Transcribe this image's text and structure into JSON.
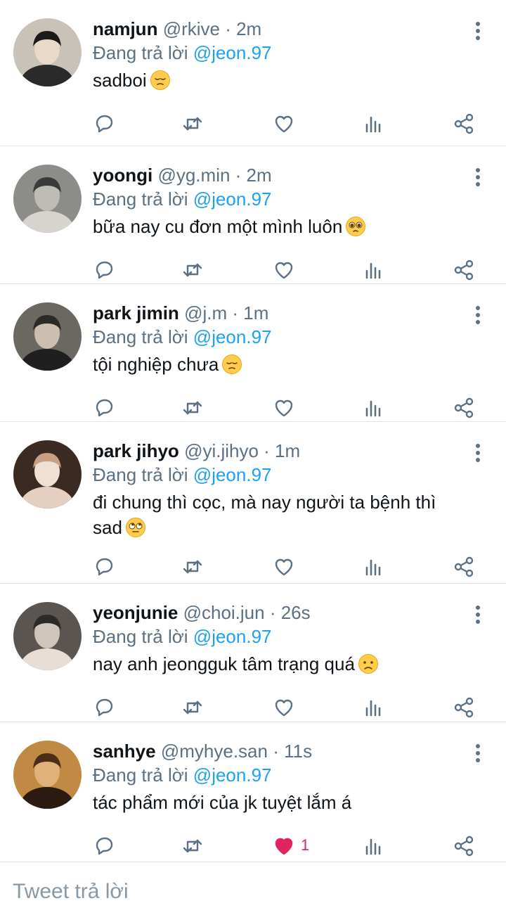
{
  "replies": [
    {
      "name": "namjun",
      "handle": "@rkive",
      "time": "· 2m",
      "replying_prefix": "Đang trả lời",
      "replying_to": "@jeon.97",
      "text": "sadboi",
      "emoji": "pensive-face",
      "liked": false,
      "like_count": ""
    },
    {
      "name": "yoongi",
      "handle": "@yg.min",
      "time": "· 2m",
      "replying_prefix": "Đang trả lời",
      "replying_to": "@jeon.97",
      "text": "bữa nay cu đơn một mình luôn",
      "emoji": "pleading-face",
      "liked": false,
      "like_count": ""
    },
    {
      "name": "park jimin",
      "handle": "@j.m",
      "time": "· 1m",
      "replying_prefix": "Đang trả lời",
      "replying_to": "@jeon.97",
      "text": "tội nghiệp chưa",
      "emoji": "pensive-face",
      "liked": false,
      "like_count": ""
    },
    {
      "name": "park jihyo",
      "handle": "@yi.jihyo",
      "time": "· 1m",
      "replying_prefix": "Đang trả lời",
      "replying_to": "@jeon.97",
      "text": "đi chung thì cọc, mà nay người ta bệnh thì sad",
      "emoji": "eye-roll-face",
      "liked": false,
      "like_count": ""
    },
    {
      "name": "yeonjunie",
      "handle": "@choi.jun",
      "time": "· 26s",
      "replying_prefix": "Đang trả lời",
      "replying_to": "@jeon.97",
      "text": "nay anh jeongguk tâm trạng quá",
      "emoji": "frowning-face",
      "liked": false,
      "like_count": ""
    },
    {
      "name": "sanhye",
      "handle": "@myhye.san",
      "time": "· 11s",
      "replying_prefix": "Đang trả lời",
      "replying_to": "@jeon.97",
      "text": "tác phẩm mới của jk tuyệt lắm á",
      "emoji": "",
      "liked": true,
      "like_count": "1"
    }
  ],
  "composer": {
    "placeholder": "Tweet trả lời"
  },
  "colors": {
    "accent": "#1da1f2",
    "secondary_text": "#5b7083",
    "icon": "#5b7083",
    "like": "#e0245e",
    "divider": "#e1e4e8"
  },
  "icons": {
    "reply": "reply-icon",
    "retweet": "retweet-icon",
    "like": "heart-icon",
    "analytics": "analytics-icon",
    "share": "share-icon",
    "more": "more-vertical-icon"
  }
}
